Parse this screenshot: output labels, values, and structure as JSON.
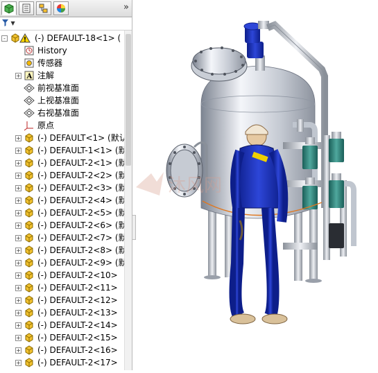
{
  "tabs": [
    {
      "name": "feature-manager-tab",
      "icon": "feature-tree-icon",
      "active": true
    },
    {
      "name": "property-manager-tab",
      "icon": "property-sheet-icon",
      "active": false
    },
    {
      "name": "configuration-manager-tab",
      "icon": "configuration-icon",
      "active": false
    },
    {
      "name": "appearance-tab",
      "icon": "appearance-pie-icon",
      "active": false
    }
  ],
  "more_label": "»",
  "filter_label": "▼",
  "tree": {
    "root": {
      "label": "(-) DEFAULT-18<1> (",
      "icon": "assembly-warning-icon"
    },
    "items": [
      {
        "label": "History",
        "icon": "history-icon",
        "expander": ""
      },
      {
        "label": "传感器",
        "icon": "sensor-icon",
        "expander": ""
      },
      {
        "label": "注解",
        "icon": "annotation-icon",
        "expander": "+"
      },
      {
        "label": "前视基准面",
        "icon": "plane-icon",
        "expander": ""
      },
      {
        "label": "上视基准面",
        "icon": "plane-icon",
        "expander": ""
      },
      {
        "label": "右视基准面",
        "icon": "plane-icon",
        "expander": ""
      },
      {
        "label": "原点",
        "icon": "origin-icon",
        "expander": ""
      },
      {
        "label": "(-) DEFAULT<1> (默认",
        "icon": "part-icon",
        "expander": "+"
      },
      {
        "label": "(-) DEFAULT-1<1> (默",
        "icon": "part-icon",
        "expander": "+"
      },
      {
        "label": "(-) DEFAULT-2<1> (默",
        "icon": "part-icon",
        "expander": "+"
      },
      {
        "label": "(-) DEFAULT-2<2> (默",
        "icon": "part-icon",
        "expander": "+"
      },
      {
        "label": "(-) DEFAULT-2<3> (默",
        "icon": "part-icon",
        "expander": "+"
      },
      {
        "label": "(-) DEFAULT-2<4> (默",
        "icon": "part-icon",
        "expander": "+"
      },
      {
        "label": "(-) DEFAULT-2<5> (默",
        "icon": "part-icon",
        "expander": "+"
      },
      {
        "label": "(-) DEFAULT-2<6> (默",
        "icon": "part-icon",
        "expander": "+"
      },
      {
        "label": "(-) DEFAULT-2<7> (默",
        "icon": "part-icon",
        "expander": "+"
      },
      {
        "label": "(-) DEFAULT-2<8> (默",
        "icon": "part-icon",
        "expander": "+"
      },
      {
        "label": "(-) DEFAULT-2<9> (默",
        "icon": "part-icon",
        "expander": "+"
      },
      {
        "label": "(-) DEFAULT-2<10>",
        "icon": "part-icon",
        "expander": "+"
      },
      {
        "label": "(-) DEFAULT-2<11>",
        "icon": "part-icon",
        "expander": "+"
      },
      {
        "label": "(-) DEFAULT-2<12>",
        "icon": "part-icon",
        "expander": "+"
      },
      {
        "label": "(-) DEFAULT-2<13>",
        "icon": "part-icon",
        "expander": "+"
      },
      {
        "label": "(-) DEFAULT-2<14>",
        "icon": "part-icon",
        "expander": "+"
      },
      {
        "label": "(-) DEFAULT-2<15>",
        "icon": "part-icon",
        "expander": "+"
      },
      {
        "label": "(-) DEFAULT-2<16>",
        "icon": "part-icon",
        "expander": "+"
      },
      {
        "label": "(-) DEFAULT-2<17>",
        "icon": "part-icon",
        "expander": "+"
      }
    ]
  },
  "viewport": {
    "watermark_text": "沐风网"
  }
}
